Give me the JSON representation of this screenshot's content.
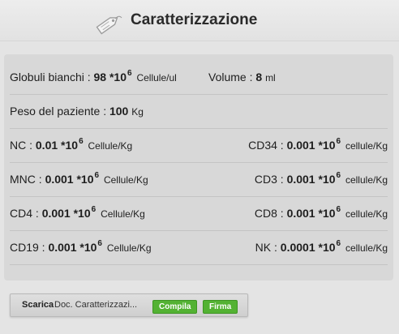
{
  "header": {
    "title": "Caratterizzazione",
    "icon": "tag-icon"
  },
  "rows": {
    "globuli": {
      "label": "Globuli bianchi :",
      "value": "98 *10",
      "exp": "6",
      "unit": "Cellule/ul"
    },
    "volume": {
      "label": "Volume :",
      "value": "8",
      "unit": "ml"
    },
    "peso": {
      "label": "Peso del paziente :",
      "value": "100",
      "unit": "Kg"
    },
    "nc": {
      "label": "NC :",
      "value": "0.01 *10",
      "exp": "6",
      "unit": "Cellule/Kg"
    },
    "cd34": {
      "label": "CD34 :",
      "value": "0.001 *10",
      "exp": "6",
      "unit": "cellule/Kg"
    },
    "mnc": {
      "label": "MNC :",
      "value": "0.001 *10",
      "exp": "6",
      "unit": "Cellule/Kg"
    },
    "cd3": {
      "label": "CD3 :",
      "value": "0.001 *10",
      "exp": "6",
      "unit": "cellule/Kg"
    },
    "cd4": {
      "label": "CD4 :",
      "value": "0.001 *10",
      "exp": "6",
      "unit": "Cellule/Kg"
    },
    "cd8": {
      "label": "CD8 :",
      "value": "0.001 *10",
      "exp": "6",
      "unit": "cellule/Kg"
    },
    "cd19": {
      "label": "CD19 :",
      "value": "0.001 *10",
      "exp": "6",
      "unit": "Cellule/Kg"
    },
    "nk": {
      "label": "NK :",
      "value": "0.0001 *10",
      "exp": "6",
      "unit": "cellule/Kg"
    }
  },
  "bottom": {
    "download_label": "Scarica",
    "doc_name": "Doc. Caratterizzazi...",
    "compila_label": "Compila",
    "firma_label": "Firma"
  },
  "colors": {
    "button_green": "#53b233",
    "background": "#e4e4e4",
    "panel": "#d8d8d8"
  }
}
